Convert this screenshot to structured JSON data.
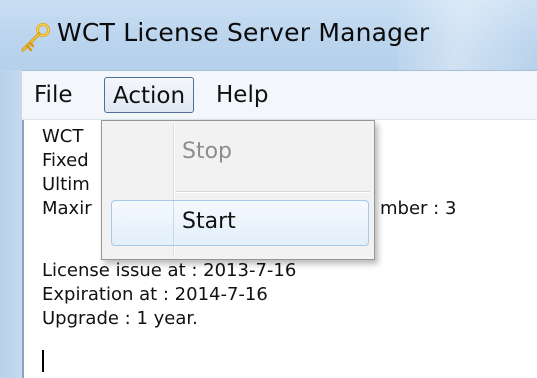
{
  "window": {
    "title": "WCT License Server Manager",
    "icon": "key-icon"
  },
  "menubar": {
    "items": [
      {
        "label": "File"
      },
      {
        "label": "Action"
      },
      {
        "label": "Help"
      }
    ]
  },
  "action_menu": {
    "items": [
      {
        "label": "Stop",
        "enabled": false
      },
      {
        "label": "Start",
        "enabled": true,
        "highlighted": true
      }
    ]
  },
  "content": {
    "visible_fragments": [
      "WCT",
      "Fixed",
      "Ultim",
      "Maxir"
    ],
    "max_number_suffix": "mber : 3",
    "lines": [
      "License issue at : 2013-7-16",
      "Expiration at : 2014-7-16",
      "Upgrade : 1 year."
    ]
  },
  "colors": {
    "titlebar": "#bcd5ee",
    "menu_highlight": "#e3effb",
    "disabled_text": "#8d8d8d"
  }
}
